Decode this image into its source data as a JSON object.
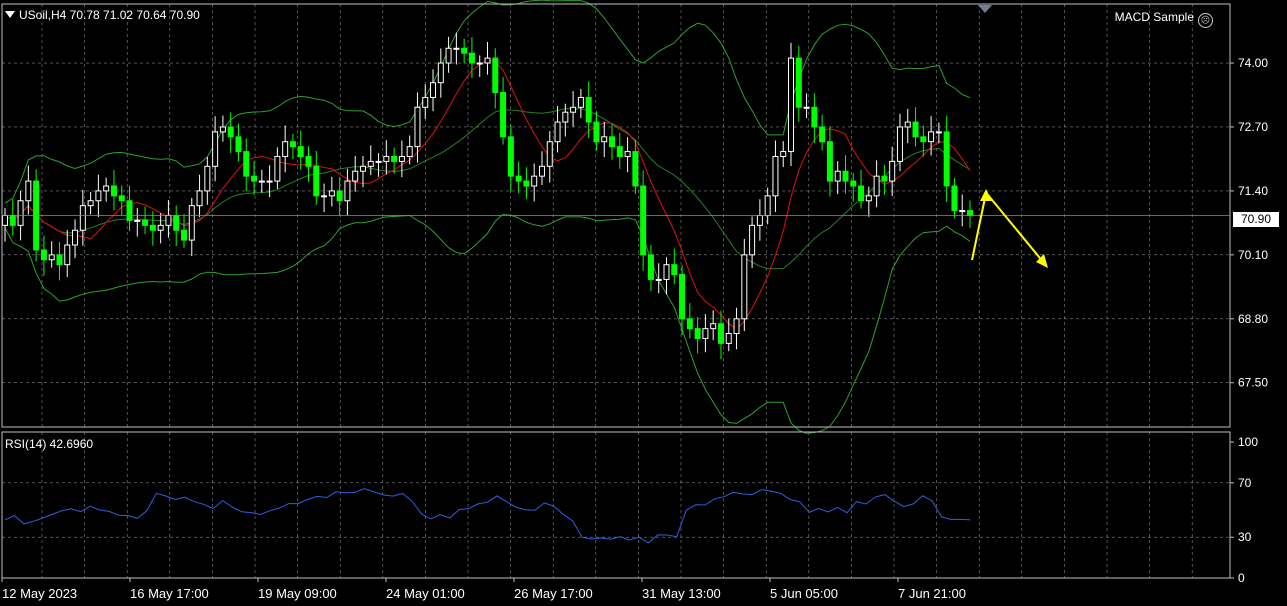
{
  "header": {
    "symbol_line": "USoil,H4  70.78 71.02 70.64 70.90",
    "expert_label": "MACD Sample",
    "expert_icon": "sad-face-icon"
  },
  "price_tag": "70.90",
  "rsi_panel": {
    "label": "RSI(14) 42.6960"
  },
  "colors": {
    "background": "#000000",
    "grid": "#c0c0c0",
    "candle_up": "#ffffff",
    "candle_down": "#00ff00",
    "bollinger": "#2ea02e",
    "moving_average": "#e01010",
    "rsi_line": "#2e5fe0",
    "arrow": "#ffff00"
  },
  "chart_data": [
    {
      "type": "candlestick",
      "symbol": "USoil",
      "timeframe": "H4",
      "ylim": [
        66.6,
        75.2
      ],
      "yticks": [
        "74.00",
        "72.70",
        "71.40",
        "70.10",
        "68.80",
        "67.50"
      ],
      "xticks": [
        "12 May 2023",
        "16 May 17:00",
        "19 May 09:00",
        "24 May 01:00",
        "26 May 17:00",
        "31 May 13:00",
        "5 Jun 05:00",
        "7 Jun 21:00"
      ],
      "last_price": 70.9,
      "close": [
        70.9,
        70.7,
        71.2,
        71.6,
        70.2,
        70.0,
        70.1,
        69.9,
        70.3,
        70.6,
        71.1,
        71.2,
        71.4,
        71.5,
        71.3,
        71.2,
        70.8,
        70.8,
        70.7,
        70.6,
        70.7,
        70.9,
        70.6,
        70.4,
        71.1,
        71.4,
        71.9,
        72.6,
        72.7,
        72.5,
        72.2,
        71.7,
        71.6,
        71.6,
        71.6,
        72.1,
        72.4,
        72.3,
        72.1,
        71.9,
        71.3,
        71.3,
        71.4,
        71.2,
        71.6,
        71.8,
        71.9,
        72.0,
        72.0,
        72.1,
        72.0,
        72.1,
        72.3,
        73.1,
        73.3,
        73.6,
        74.0,
        74.3,
        74.3,
        74.2,
        74.0,
        74.0,
        74.1,
        73.4,
        72.5,
        71.7,
        71.6,
        71.5,
        71.7,
        71.9,
        72.4,
        72.8,
        73.0,
        73.1,
        73.3,
        72.8,
        72.4,
        72.5,
        72.3,
        72.1,
        72.2,
        71.5,
        70.1,
        69.6,
        69.6,
        69.9,
        69.7,
        68.8,
        68.6,
        68.4,
        68.6,
        68.7,
        68.3,
        68.5,
        68.8,
        70.1,
        70.7,
        70.9,
        71.3,
        72.1,
        72.2,
        74.1,
        73.1,
        73.1,
        72.7,
        72.4,
        71.6,
        71.8,
        71.6,
        71.5,
        71.2,
        71.3,
        71.7,
        71.6,
        72.0,
        72.7,
        72.8,
        72.5,
        72.4,
        72.6,
        72.6,
        71.5,
        71.0,
        71.0,
        70.9
      ]
    },
    {
      "type": "line",
      "title": "RSI(14) 42.6960",
      "ylim": [
        0,
        100
      ],
      "yticks": [
        100,
        70,
        30,
        0
      ],
      "values": [
        42.7,
        45.9,
        39.8,
        41.7,
        44.1,
        46.8,
        49.5,
        50.9,
        48.8,
        52.8,
        50.0,
        49.0,
        46.1,
        45.9,
        43.8,
        49.6,
        62.3,
        60.3,
        57.7,
        59.4,
        56.1,
        54.2,
        51.0,
        56.9,
        52.2,
        48.7,
        48.1,
        46.7,
        49.5,
        51.5,
        54.7,
        54.7,
        57.7,
        60.0,
        59.2,
        63.4,
        62.6,
        63.0,
        65.7,
        63.3,
        61.1,
        60.2,
        62.2,
        56.8,
        47.3,
        43.4,
        46.5,
        44.2,
        50.3,
        51.0,
        54.5,
        55.7,
        60.4,
        56.2,
        52.1,
        50.2,
        49.8,
        55.2,
        52.9,
        46.9,
        42.0,
        30.0,
        28.7,
        29.5,
        28.5,
        30.4,
        27.9,
        30.0,
        25.8,
        31.7,
        31.6,
        30.4,
        49.8,
        53.8,
        53.7,
        58.2,
        59.8,
        63.0,
        61.8,
        61.4,
        65.0,
        63.8,
        62.3,
        57.7,
        56.0,
        48.2,
        51.2,
        48.5,
        51.8,
        48.0,
        56.2,
        54.4,
        59.6,
        61.3,
        56.4,
        52.5,
        54.5,
        60.5,
        56.6,
        44.9,
        43.0,
        43.2,
        42.7
      ]
    }
  ]
}
